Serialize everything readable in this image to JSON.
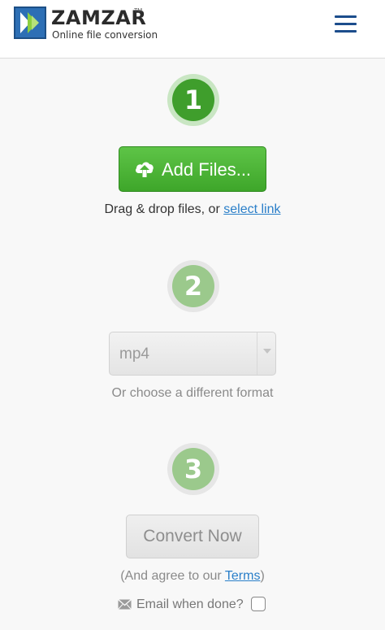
{
  "header": {
    "brand": "ZAMZAR",
    "trademark": "TM",
    "tagline": "Online file conversion",
    "logo_icon": "zamzar-logo-icon",
    "menu_icon": "hamburger-menu-icon"
  },
  "steps": {
    "one": "1",
    "two": "2",
    "three": "3"
  },
  "upload": {
    "button_label": "Add Files...",
    "button_icon": "cloud-upload-icon",
    "drag_text": "Drag & drop files, or",
    "select_link": "select link"
  },
  "format": {
    "selected": "mp4",
    "hint": "Or choose a different format"
  },
  "convert": {
    "button_label": "Convert Now",
    "agree_prefix": "(And agree to our",
    "terms_link": "Terms",
    "agree_suffix": ")",
    "email_label": "Email when done?",
    "email_icon": "envelope-icon",
    "email_checked": false
  },
  "colors": {
    "primary_green": "#3ea62a",
    "muted_green": "#9bc98c",
    "link_blue": "#2a7fc9",
    "menu_blue": "#1c4d8c"
  }
}
